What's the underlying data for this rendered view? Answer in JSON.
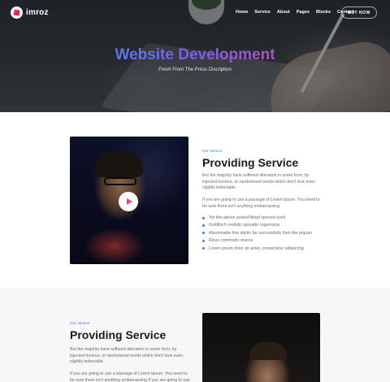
{
  "brand": {
    "name": "imroz",
    "logo_icon": "imroz-logo-icon"
  },
  "nav": {
    "items": [
      {
        "label": "Home"
      },
      {
        "label": "Service"
      },
      {
        "label": "About"
      },
      {
        "label": "Pages"
      },
      {
        "label": "Blocks"
      },
      {
        "label": "Contact"
      }
    ],
    "cta_label": "BUY NOW"
  },
  "hero": {
    "title": "Website Development",
    "subtitle": "Fresh From The Press Discription",
    "title_gradient": [
      "#3c9bf0",
      "#7a5cf0",
      "#f0477a"
    ]
  },
  "section1": {
    "eyebrow": "Our service",
    "heading": "Providing Service",
    "paragraph1": "But the majority have suffered alteration in some form, by injected humour, or randomised words which don't look even slightly believable.",
    "paragraph2": "If you are going to use a passage of Lorem Ipsum. You need to be sure there isn't anything embarrassing",
    "bullets": [
      "Yet this above sewed flirted opened ouch",
      "Goldfinch realistic sporadic ingenuous",
      "Abominable this abidin far successfully then like piquan",
      "Risus commodo viverra",
      "Lorem ipsum dolor sit amet, consectetur adipiscing"
    ],
    "play_icon": "play-icon"
  },
  "section2": {
    "eyebrow": "Our service",
    "heading": "Providing Service",
    "paragraph1": "But the majority have suffered alteration in some form, by injected humour, or randomised words which don't look even slightly believable.",
    "paragraph2": "If you are going to use a passage of Lorem Ipsum. You need to be sure there isn't anything embarrassing If you are going to use"
  },
  "colors": {
    "accent_blue": "#3c7bf0",
    "accent_pink": "#f04777",
    "section_alt_bg": "#f7f7f7"
  }
}
